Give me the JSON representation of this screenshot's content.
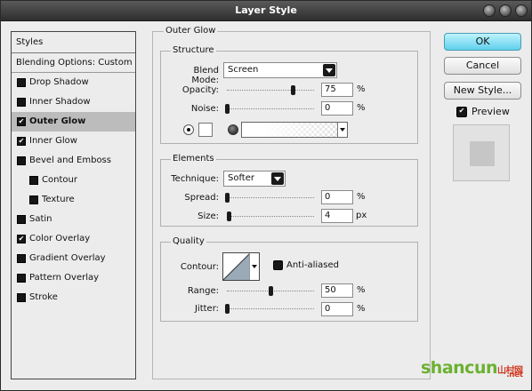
{
  "window": {
    "title": "Layer Style"
  },
  "styles_panel": {
    "header": "Styles",
    "blending": "Blending Options: Custom",
    "items": [
      {
        "label": "Drop Shadow",
        "checked": false,
        "selected": false,
        "indent": false
      },
      {
        "label": "Inner Shadow",
        "checked": false,
        "selected": false,
        "indent": false
      },
      {
        "label": "Outer Glow",
        "checked": true,
        "selected": true,
        "indent": false
      },
      {
        "label": "Inner Glow",
        "checked": true,
        "selected": false,
        "indent": false
      },
      {
        "label": "Bevel and Emboss",
        "checked": false,
        "selected": false,
        "indent": false
      },
      {
        "label": "Contour",
        "checked": false,
        "selected": false,
        "indent": true
      },
      {
        "label": "Texture",
        "checked": false,
        "selected": false,
        "indent": true
      },
      {
        "label": "Satin",
        "checked": false,
        "selected": false,
        "indent": false
      },
      {
        "label": "Color Overlay",
        "checked": true,
        "selected": false,
        "indent": false
      },
      {
        "label": "Gradient Overlay",
        "checked": false,
        "selected": false,
        "indent": false
      },
      {
        "label": "Pattern Overlay",
        "checked": false,
        "selected": false,
        "indent": false
      },
      {
        "label": "Stroke",
        "checked": false,
        "selected": false,
        "indent": false
      }
    ]
  },
  "outer_glow": {
    "title": "Outer Glow",
    "structure": {
      "title": "Structure",
      "blend_mode_label": "Blend Mode:",
      "blend_mode": "Screen",
      "opacity_label": "Opacity:",
      "opacity": "75",
      "opacity_pct": 75,
      "noise_label": "Noise:",
      "noise": "0",
      "noise_pct": 0,
      "unit": "%"
    },
    "elements": {
      "title": "Elements",
      "technique_label": "Technique:",
      "technique": "Softer",
      "spread_label": "Spread:",
      "spread": "0",
      "spread_pct": 0,
      "spread_unit": "%",
      "size_label": "Size:",
      "size": "4",
      "size_fraction": 0.02,
      "size_unit": "px"
    },
    "quality": {
      "title": "Quality",
      "contour_label": "Contour:",
      "anti_aliased_label": "Anti-aliased",
      "anti_aliased": false,
      "range_label": "Range:",
      "range": "50",
      "range_pct": 50,
      "range_unit": "%",
      "jitter_label": "Jitter:",
      "jitter": "0",
      "jitter_pct": 0,
      "jitter_unit": "%"
    }
  },
  "buttons": {
    "ok": "OK",
    "cancel": "Cancel",
    "new_style": "New Style..."
  },
  "preview": {
    "label": "Preview",
    "checked": true
  },
  "watermark": {
    "main": "shancun",
    "cn": "山村网",
    "net": ".net"
  },
  "colors": {
    "accent": "#5fd0ec",
    "watermark": "#6bb131",
    "watermark_alt": "#d03c26"
  }
}
